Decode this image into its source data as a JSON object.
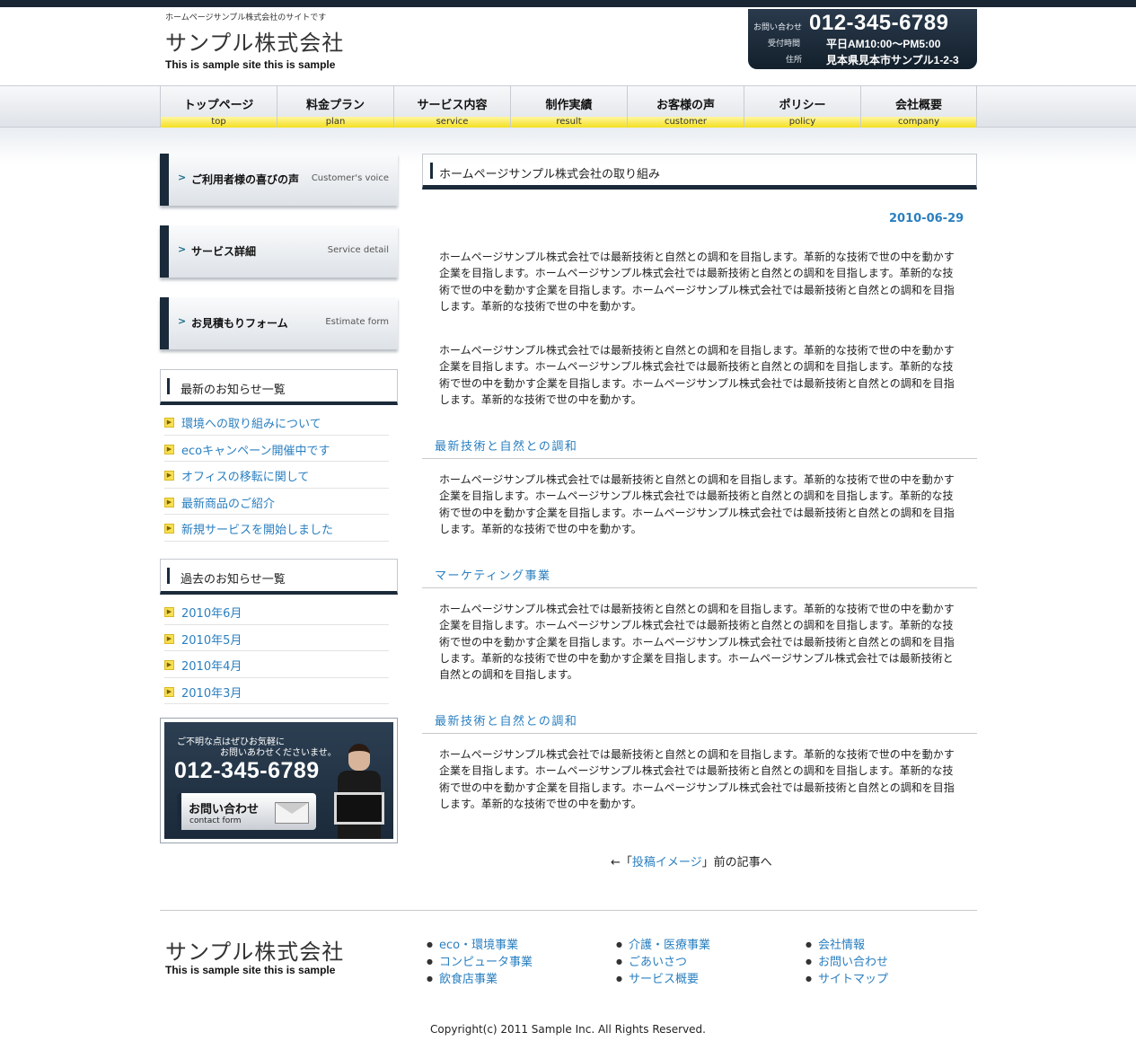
{
  "header": {
    "tagline": "ホームページサンプル株式会社のサイトです",
    "logo_jp": "サンプル株式会社",
    "logo_en": "This is sample site this is sample",
    "contact_label": "お問い合わせ",
    "phone": "012-345-6789",
    "hours_label": "受付時間",
    "hours": "平日AM10:00〜PM5:00",
    "address_label": "住所",
    "address": "見本県見本市サンプル1-2-3"
  },
  "nav": [
    {
      "jp": "トップページ",
      "en": "top"
    },
    {
      "jp": "料金プラン",
      "en": "plan"
    },
    {
      "jp": "サービス内容",
      "en": "service"
    },
    {
      "jp": "制作実績",
      "en": "result"
    },
    {
      "jp": "お客様の声",
      "en": "customer"
    },
    {
      "jp": "ポリシー",
      "en": "policy"
    },
    {
      "jp": "会社概要",
      "en": "company"
    }
  ],
  "sidebar": {
    "buttons": [
      {
        "jp": "ご利用者様の喜びの声",
        "en": "Customer's voice"
      },
      {
        "jp": "サービス詳細",
        "en": "Service detail"
      },
      {
        "jp": "お見積もりフォーム",
        "en": "Estimate form"
      }
    ],
    "latest_title": "最新のお知らせ一覧",
    "latest": [
      "環境への取り組みについて",
      "ecoキャンペーン開催中です",
      "オフィスの移転に関して",
      "最新商品のご紹介",
      "新規サービスを開始しました"
    ],
    "past_title": "過去のお知らせ一覧",
    "past": [
      "2010年6月",
      "2010年5月",
      "2010年4月",
      "2010年3月"
    ],
    "banner": {
      "line1": "ご不明な点はぜひお気軽に",
      "line2": "お問いあわせくださいませ。",
      "phone": "012-345-6789",
      "button_jp": "お問い合わせ",
      "button_en": "contact form"
    }
  },
  "main": {
    "title": "ホームページサンプル株式会社の取り組み",
    "date": "2010-06-29",
    "p1": "ホームページサンプル株式会社では最新技術と自然との調和を目指します。革新的な技術で世の中を動かす企業を目指します。ホームページサンプル株式会社では最新技術と自然との調和を目指します。革新的な技術で世の中を動かす企業を目指します。ホームページサンプル株式会社では最新技術と自然との調和を目指します。革新的な技術で世の中を動かす。",
    "p2": "ホームページサンプル株式会社では最新技術と自然との調和を目指します。革新的な技術で世の中を動かす企業を目指します。ホームページサンプル株式会社では最新技術と自然との調和を目指します。革新的な技術で世の中を動かす企業を目指します。ホームページサンプル株式会社では最新技術と自然との調和を目指します。革新的な技術で世の中を動かす。",
    "h1": "最新技術と自然との調和",
    "p3": "ホームページサンプル株式会社では最新技術と自然との調和を目指します。革新的な技術で世の中を動かす企業を目指します。ホームページサンプル株式会社では最新技術と自然との調和を目指します。革新的な技術で世の中を動かす企業を目指します。ホームページサンプル株式会社では最新技術と自然との調和を目指します。革新的な技術で世の中を動かす。",
    "h2": "マーケティング事業",
    "p4": "ホームページサンプル株式会社では最新技術と自然との調和を目指します。革新的な技術で世の中を動かす企業を目指します。ホームページサンプル株式会社では最新技術と自然との調和を目指します。革新的な技術で世の中を動かす企業を目指します。ホームページサンプル株式会社では最新技術と自然との調和を目指します。革新的な技術で世の中を動かす企業を目指します。ホームページサンプル株式会社では最新技術と自然との調和を目指します。",
    "h3": "最新技術と自然との調和",
    "p5": "ホームページサンプル株式会社では最新技術と自然との調和を目指します。革新的な技術で世の中を動かす企業を目指します。ホームページサンプル株式会社では最新技術と自然との調和を目指します。革新的な技術で世の中を動かす企業を目指します。ホームページサンプル株式会社では最新技術と自然との調和を目指します。革新的な技術で世の中を動かす。",
    "prev_prefix": "←「",
    "prev_link": "投稿イメージ",
    "prev_suffix": "」前の記事へ"
  },
  "footer": {
    "logo_jp": "サンプル株式会社",
    "logo_en": "This is sample site this is sample",
    "col1": [
      "eco・環境事業",
      "コンピュータ事業",
      "飲食店事業"
    ],
    "col2": [
      "介護・医療事業",
      "ごあいさつ",
      "サービス概要"
    ],
    "col3": [
      "会社情報",
      "お問い合わせ",
      "サイトマップ"
    ],
    "copyright": "Copyright(c) 2011 Sample Inc. All Rights Reserved."
  }
}
